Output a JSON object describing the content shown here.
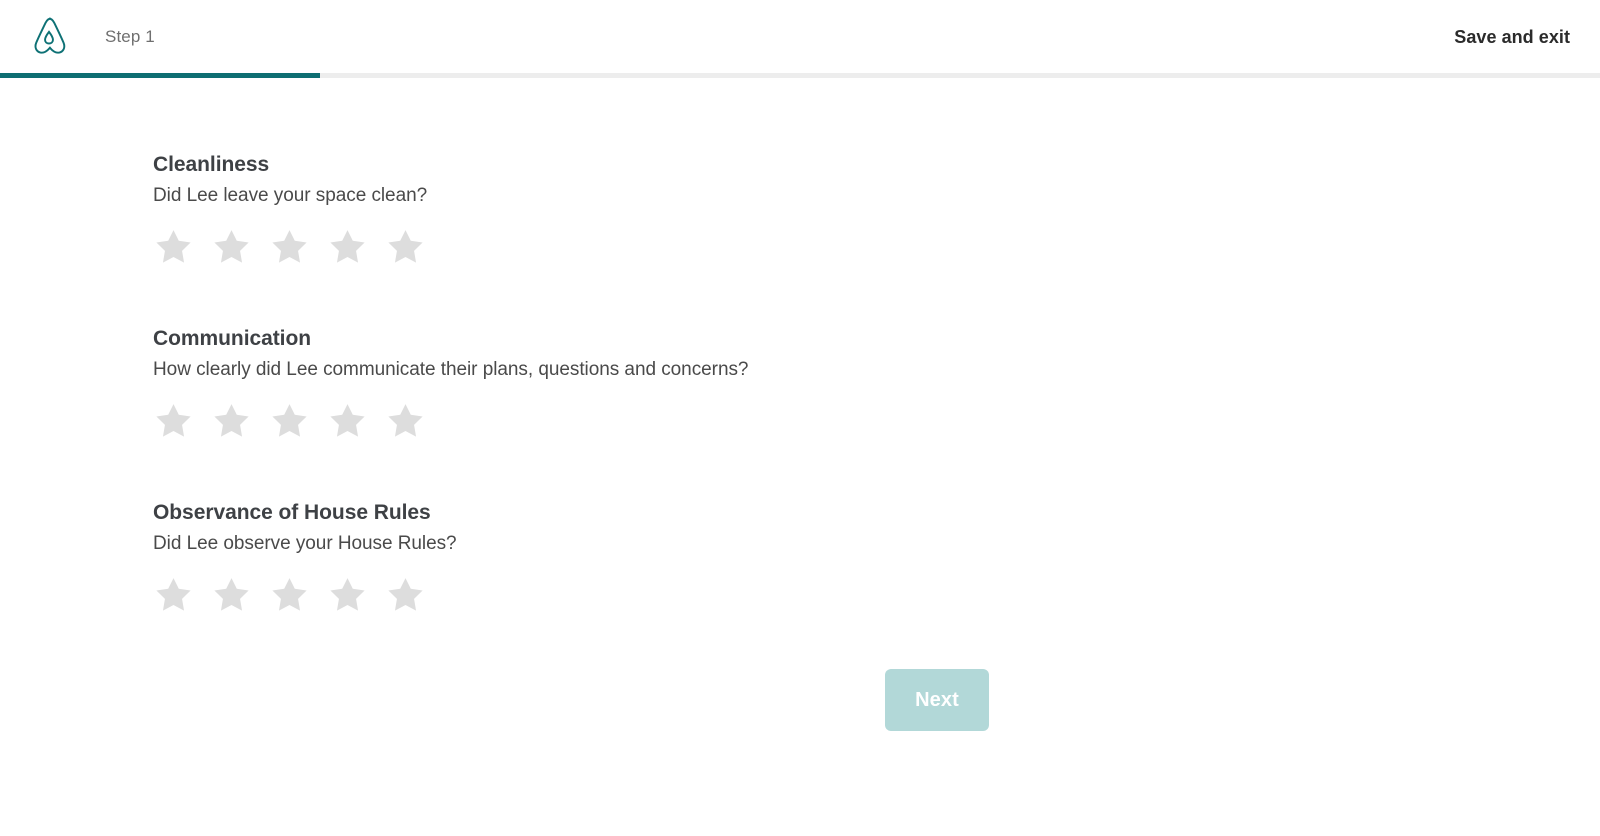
{
  "header": {
    "logo_icon": "airbnb-belo-logo",
    "step_label": "Step 1",
    "save_exit_label": "Save and exit",
    "brand_color": "#0e6e72"
  },
  "progress": {
    "percent": 20,
    "fill_color": "#0e6e72",
    "track_color": "#ededed"
  },
  "ratings": [
    {
      "title": "Cleanliness",
      "question": "Did Lee leave your space clean?",
      "value": 0,
      "max": 5,
      "star_color": "#dddddd"
    },
    {
      "title": "Communication",
      "question": "How clearly did Lee communicate their plans, questions and concerns?",
      "value": 0,
      "max": 5,
      "star_color": "#dddddd"
    },
    {
      "title": "Observance of House Rules",
      "question": "Did Lee observe your House Rules?",
      "value": 0,
      "max": 5,
      "star_color": "#dddddd"
    }
  ],
  "footer": {
    "next_label": "Next",
    "next_color": "#b2d8d8",
    "next_disabled": true
  }
}
